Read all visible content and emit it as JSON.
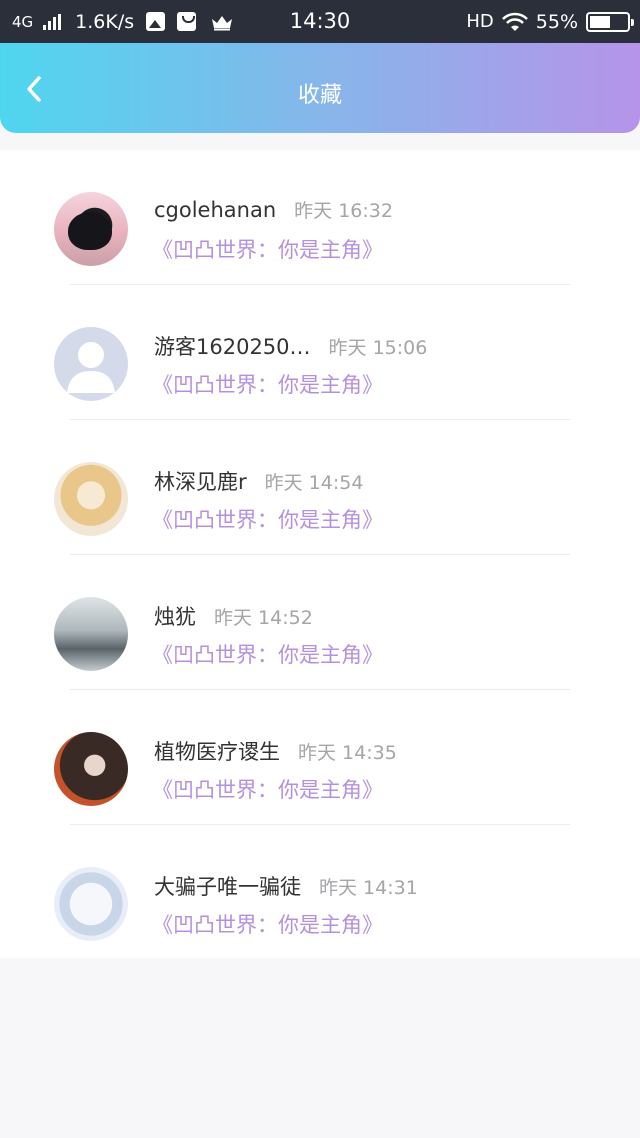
{
  "status_bar": {
    "network": "4G",
    "speed": "1.6K/s",
    "time": "14:30",
    "hd": "HD",
    "battery_text": "55%",
    "battery_level": 0.55
  },
  "header": {
    "title": "收藏",
    "back_icon": "chevron-left-icon"
  },
  "colors": {
    "status_bar_bg": "#2a2f3a",
    "header_gradient_start": "#4fd6ef",
    "header_gradient_end": "#b694e9",
    "game_link": "#b591dd",
    "time_text": "#a5a5a8"
  },
  "items": [
    {
      "name": "cgolehanan",
      "time": "昨天 16:32",
      "game": "《凹凸世界：你是主角》",
      "avatar": "black-cat-avatar"
    },
    {
      "name": "游客1620250…",
      "time": "昨天 15:06",
      "game": "《凹凸世界：你是主角》",
      "avatar": "default-guest-avatar"
    },
    {
      "name": "林深见鹿r",
      "time": "昨天 14:54",
      "game": "《凹凸世界：你是主角》",
      "avatar": "anime-girl-avatar"
    },
    {
      "name": "烛犹",
      "time": "昨天 14:52",
      "game": "《凹凸世界：你是主角》",
      "avatar": "foggy-forest-avatar"
    },
    {
      "name": "植物医疗谡生",
      "time": "昨天 14:35",
      "game": "《凹凸世界：你是主角》",
      "avatar": "girl-photo-avatar"
    },
    {
      "name": "大骗子唯一骗徒",
      "time": "昨天 14:31",
      "game": "《凹凸世界：你是主角》",
      "avatar": "anime-character-avatar"
    }
  ]
}
